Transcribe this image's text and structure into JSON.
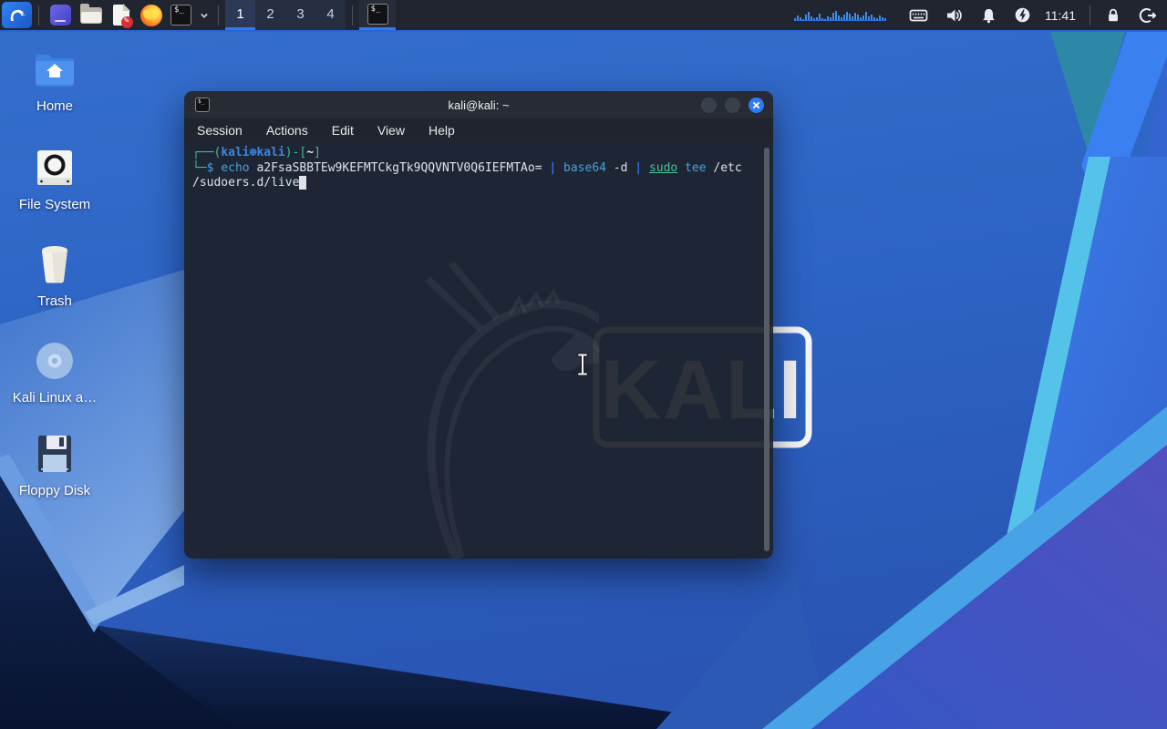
{
  "panel": {
    "launchers": [
      {
        "name": "kali-menu-icon"
      },
      {
        "name": "app-launcher-icon"
      },
      {
        "name": "file-manager-icon"
      },
      {
        "name": "text-editor-icon"
      },
      {
        "name": "firefox-icon"
      },
      {
        "name": "terminal-launcher-icon"
      },
      {
        "name": "chevron-down-icon"
      }
    ],
    "workspaces": [
      "1",
      "2",
      "3",
      "4"
    ],
    "active_workspace": "1",
    "task_button": {
      "name": "terminal-task",
      "active": true
    },
    "cpu_bars": [
      2,
      5,
      3,
      1,
      6,
      9,
      4,
      2,
      3,
      7,
      2,
      1,
      4,
      3,
      8,
      10,
      5,
      3,
      6,
      9,
      7,
      4,
      8,
      6,
      3,
      5,
      9,
      4,
      6,
      3,
      2,
      5,
      3,
      2
    ],
    "clock": "11:41",
    "tray_icons": [
      "keyboard-icon",
      "volume-icon",
      "notifications-bell-icon",
      "power-manager-icon"
    ],
    "session_icons": [
      "lock-icon",
      "logout-icon"
    ],
    "accent_color": "#2e7cf0"
  },
  "desktop": {
    "icons": [
      {
        "label": "Home",
        "icon": "home-folder"
      },
      {
        "label": "File System",
        "icon": "file-system-drive"
      },
      {
        "label": "Trash",
        "icon": "trash-can"
      },
      {
        "label": "Kali Linux a…",
        "icon": "cd-disc"
      },
      {
        "label": "Floppy Disk",
        "icon": "floppy-disk"
      }
    ]
  },
  "wallpaper": {
    "logo_text": "KALI",
    "main_blue": "#3168c9",
    "dark_navy": "#0b1838",
    "purple": "#5150c0",
    "cyan_edge": "#55c2ea"
  },
  "window": {
    "title": "kali@kali: ~",
    "menu": [
      "Session",
      "Actions",
      "Edit",
      "View",
      "Help"
    ],
    "controls": [
      "minimize",
      "maximize",
      "close"
    ],
    "terminal": {
      "lines": [
        [
          {
            "t": "┌──(",
            "c": "frame"
          },
          {
            "t": "kali⊛kali",
            "c": "user"
          },
          {
            "t": ")-[",
            "c": "frame"
          },
          {
            "t": "~",
            "c": "path"
          },
          {
            "t": "]",
            "c": "frame"
          }
        ],
        [
          {
            "t": "└─",
            "c": "frame"
          },
          {
            "t": "$",
            "c": "dollar"
          },
          {
            "t": " ",
            "c": "plain"
          },
          {
            "t": "echo",
            "c": "cmd"
          },
          {
            "t": " a2FsaSBBTEw9KEFMTCkgTk9QQVNTV0Q6IEFMTAo= ",
            "c": "plain"
          },
          {
            "t": "|",
            "c": "pipe"
          },
          {
            "t": " ",
            "c": "plain"
          },
          {
            "t": "base64",
            "c": "cmd"
          },
          {
            "t": " -d ",
            "c": "plain"
          },
          {
            "t": "|",
            "c": "pipe"
          },
          {
            "t": " ",
            "c": "plain"
          },
          {
            "t": "sudo",
            "c": "sudo"
          },
          {
            "t": " ",
            "c": "plain"
          },
          {
            "t": "tee",
            "c": "cmd"
          },
          {
            "t": " /etc",
            "c": "plain"
          }
        ],
        [
          {
            "t": "/sudoers.d/live",
            "c": "plain"
          },
          {
            "t": " ",
            "c": "cursor"
          }
        ]
      ]
    }
  }
}
